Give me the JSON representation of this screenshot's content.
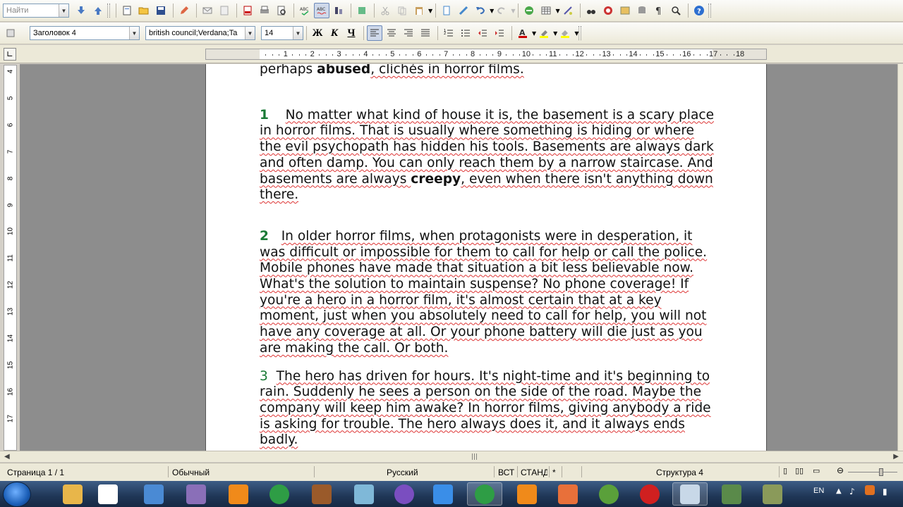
{
  "toolbar_find": {
    "placeholder": "Найти"
  },
  "toolbar_format": {
    "style_value": "Заголовок 4",
    "font_value": "british council;Verdana;Ta",
    "size_value": "14",
    "bold_label": "Ж",
    "italic_label": "К",
    "underline_label": "Ч",
    "font_color": "#cc0000",
    "highlight_color": "#ffff00"
  },
  "ruler": {
    "marks": [
      "1",
      "2",
      "3",
      "4",
      "5",
      "6",
      "7",
      "8",
      "9",
      "10",
      "11",
      "12",
      "13",
      "14",
      "15",
      "16",
      "17",
      "18"
    ],
    "vmarks": [
      "4",
      "5",
      "6",
      "7",
      "8",
      "9",
      "10",
      "11",
      "12",
      "13",
      "14",
      "15",
      "16",
      "17"
    ]
  },
  "document": {
    "intro_line_1": "perhaps ",
    "intro_bold": "abused",
    "intro_line_2": ", clichés in horror films.",
    "p1_num": "1",
    "p1_text_a": "No matter what kind of house it is, the basement is a scary place in horror films. That is usually where something is hiding or where the evil psychopath has hidden his tools. Basements are always dark and often damp. You can only reach them by a narrow staircase. And basements are always ",
    "p1_bold": "creepy",
    "p1_text_b": ", even when there isn't anything down there.",
    "p2_num": "2",
    "p2_text": "In older horror films, when protagonists were in desperation, it was difficult or impossible for them to call for help or call the police. Mobile phones have made that situation a bit less believable now. What's the solution to maintain suspense? No phone coverage! If you're a hero in a horror film, it's almost certain that at a key moment, just when you absolutely need to call for help, you will not have any coverage at all. Or your phone battery will die just as you are making the call. Or both.",
    "p3_num": "3",
    "p3_text": "The hero has driven for hours. It's night-time and it's beginning to rain. Suddenly he sees a person on the side of the road. Maybe the company will keep him awake? In horror films, giving anybody a ride is asking for trouble. The hero always does it, and it always ends badly."
  },
  "statusbar": {
    "page": "Страница 1 / 1",
    "style": "Обычный",
    "language": "Русский",
    "insert_mode": "ВСТ",
    "selection_mode": "СТАНД",
    "modified": "*",
    "outline": "Структура 4"
  },
  "taskbar": {
    "lang": "EN",
    "apps": [
      "explorer",
      "solitaire",
      "calculator",
      "tool",
      "vlc",
      "chrome",
      "video-editor",
      "notepad",
      "viber",
      "media-player",
      "chrome-2",
      "settings",
      "pdf",
      "utorrent",
      "opera",
      "writer",
      "game-1",
      "game-2"
    ]
  }
}
